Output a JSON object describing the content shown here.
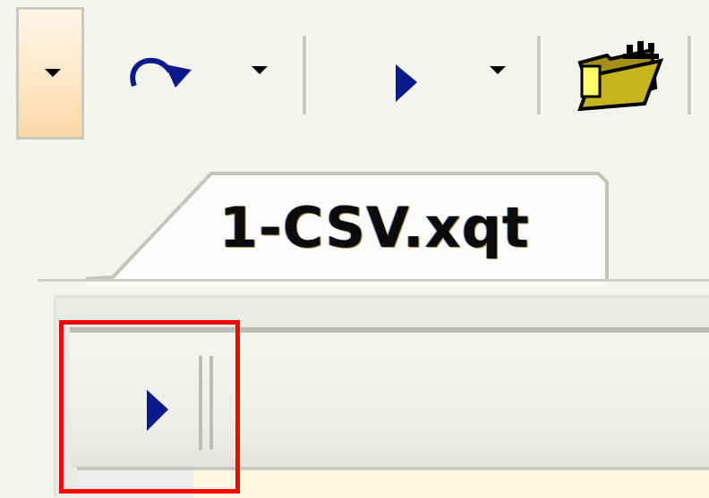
{
  "toolbar": {
    "buttons": [
      {
        "name": "dropdown-arrow-button",
        "icon": "chevron-down-icon",
        "state": "pressed"
      },
      {
        "name": "redo-button",
        "icon": "redo-icon"
      },
      {
        "name": "redo-dropdown-button",
        "icon": "chevron-down-icon"
      },
      {
        "name": "run-button",
        "icon": "play-icon"
      },
      {
        "name": "run-dropdown-button",
        "icon": "chevron-down-icon"
      },
      {
        "name": "open-folder-button",
        "icon": "folder-open-icon"
      }
    ]
  },
  "tabs": [
    {
      "label": "1-CSV.xqt",
      "active": true
    }
  ],
  "query_toolbar": {
    "run_icon": "play-icon",
    "highlighted": true
  },
  "colors": {
    "accent_play": "#0a1a8c",
    "highlight": "#ff0000",
    "pressed_bg": "#fbd7a7"
  }
}
